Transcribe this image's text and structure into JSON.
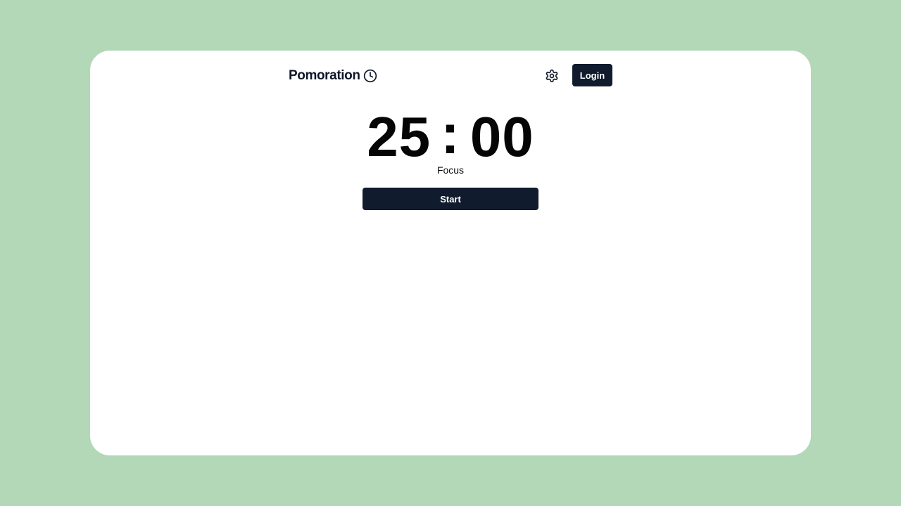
{
  "app": {
    "name": "Pomoration",
    "logo_icon": "clock-icon"
  },
  "header": {
    "settings_icon": "gear-icon",
    "login_label": "Login"
  },
  "timer": {
    "minutes": "25",
    "separator": ":",
    "seconds": "00",
    "mode": "Focus"
  },
  "controls": {
    "start_label": "Start"
  },
  "colors": {
    "background": "#b3d8b8",
    "card": "#ffffff",
    "button": "#111b2e",
    "text": "#0f172a"
  }
}
